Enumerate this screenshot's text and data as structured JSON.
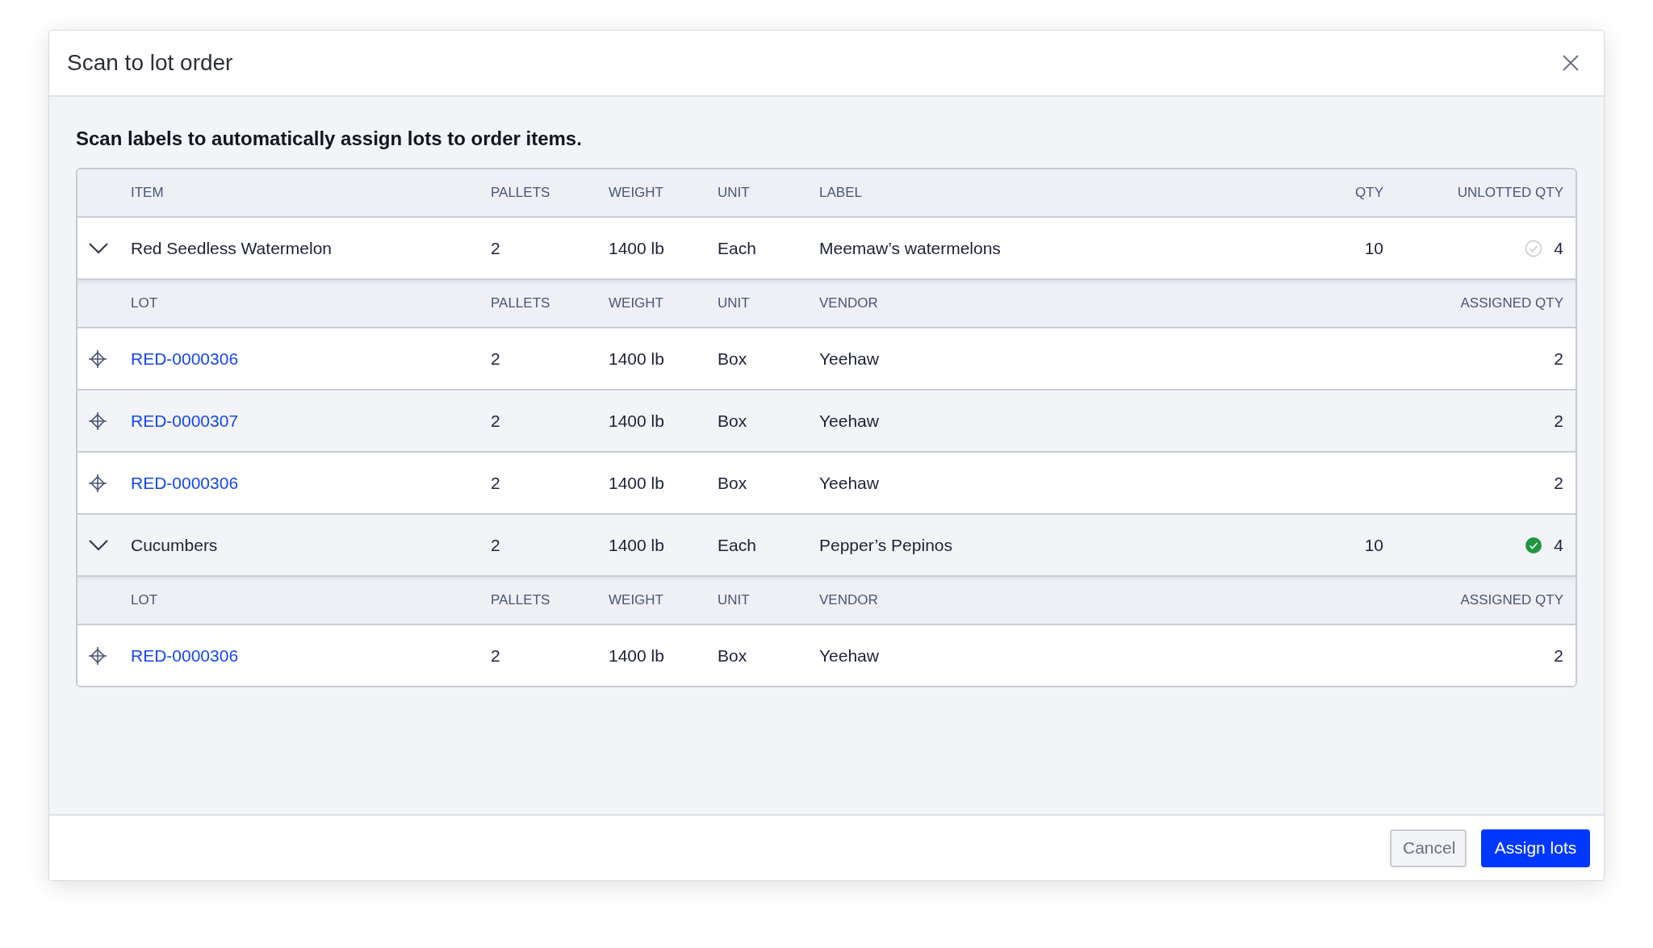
{
  "dialog": {
    "title": "Scan to lot order",
    "description": "Scan labels to automatically assign lots to order items."
  },
  "table": {
    "columns": [
      "ITEM",
      "PALLETS",
      "WEIGHT",
      "UNIT",
      "LABEL",
      "QTY",
      "UNLOTTED QTY"
    ],
    "items": [
      {
        "item": "Red Seedless Watermelon",
        "pallets": "2",
        "weight": "1400 lb",
        "unit": "Each",
        "label": "Meemaw’s watermelons",
        "qty": "10",
        "unlotted_qty": "4",
        "complete": false,
        "expanded": true,
        "lot_columns": [
          "LOT",
          "PALLETS",
          "WEIGHT",
          "UNIT",
          "VENDOR",
          "ASSIGNED QTY"
        ],
        "lots": [
          {
            "lot": "RED-0000306",
            "pallets": "2",
            "weight": "1400 lb",
            "unit": "Box",
            "vendor": "Yeehaw",
            "assigned_qty": "2"
          },
          {
            "lot": "RED-0000307",
            "pallets": "2",
            "weight": "1400 lb",
            "unit": "Box",
            "vendor": "Yeehaw",
            "assigned_qty": "2"
          },
          {
            "lot": "RED-0000306",
            "pallets": "2",
            "weight": "1400 lb",
            "unit": "Box",
            "vendor": "Yeehaw",
            "assigned_qty": "2"
          }
        ]
      },
      {
        "item": "Cucumbers",
        "pallets": "2",
        "weight": "1400 lb",
        "unit": "Each",
        "label": "Pepper’s Pepinos",
        "qty": "10",
        "unlotted_qty": "4",
        "complete": true,
        "expanded": true,
        "lot_columns": [
          "LOT",
          "PALLETS",
          "WEIGHT",
          "UNIT",
          "VENDOR",
          "ASSIGNED QTY"
        ],
        "lots": [
          {
            "lot": "RED-0000306",
            "pallets": "2",
            "weight": "1400 lb",
            "unit": "Box",
            "vendor": "Yeehaw",
            "assigned_qty": "2"
          }
        ]
      }
    ]
  },
  "buttons": {
    "cancel": "Cancel",
    "confirm": "Assign lots"
  }
}
